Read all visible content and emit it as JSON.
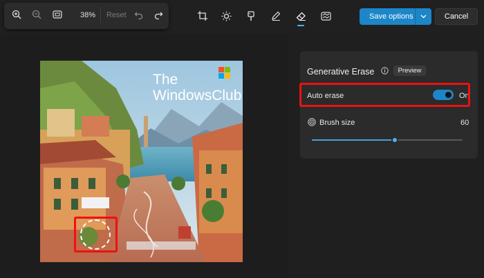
{
  "toolbar": {
    "zoom_level": "38%",
    "reset_label": "Reset",
    "icons": [
      "zoom-in-icon",
      "zoom-out-icon",
      "fit-to-window-icon",
      "undo-icon",
      "redo-icon"
    ]
  },
  "tools": [
    "crop-icon",
    "brightness-icon",
    "filter-icon",
    "markup-icon",
    "erase-icon",
    "background-icon"
  ],
  "actions": {
    "save_label": "Save options",
    "cancel_label": "Cancel"
  },
  "image": {
    "watermark_line1": "The",
    "watermark_line2": "WindowsClub"
  },
  "panel": {
    "title": "Generative Erase",
    "badge": "Preview",
    "auto_erase_label": "Auto erase",
    "auto_erase_state": "On",
    "auto_erase_on": true,
    "brush_size_label": "Brush size",
    "brush_size_value": "60",
    "brush_size_fraction": 0.55
  },
  "colors": {
    "accent": "#1c86c9",
    "highlight": "#e11111",
    "background": "#202020"
  }
}
